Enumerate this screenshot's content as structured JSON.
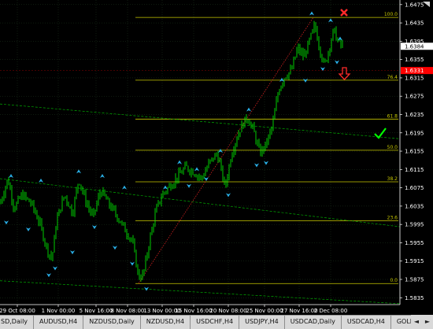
{
  "chart_data": {
    "type": "candlestick",
    "y_ticks": [
      "1.6475",
      "1.6435",
      "1.6395",
      "1.6355",
      "1.6315",
      "1.6275",
      "1.6235",
      "1.6195",
      "1.6155",
      "1.6115",
      "1.6075",
      "1.6035",
      "1.5995",
      "1.5955",
      "1.5915",
      "1.5875",
      "1.5835"
    ],
    "price_current": "1.6384",
    "price_marker": "1.6331",
    "x_ticks": [
      "29 Oct 08:00",
      "1 Nov 00:00",
      "5 Nov 16:00",
      "8 Nov 08:00",
      "13 Nov 00:00",
      "15 Nov 16:00",
      "20 Nov 08:00",
      "25 Nov 00:00",
      "27 Nov 16:00",
      "2 Dec 08:00"
    ],
    "fib_levels": [
      {
        "label": "100.0",
        "value": 1.6447
      },
      {
        "label": "76.4",
        "value": 1.631
      },
      {
        "label": "61.8",
        "value": 1.6225
      },
      {
        "label": "50.0",
        "value": 1.6157
      },
      {
        "label": "38.2",
        "value": 1.6088
      },
      {
        "label": "23.6",
        "value": 1.6003
      },
      {
        "label": "0.0",
        "value": 1.5866
      }
    ],
    "ylim": [
      1.582,
      1.6485
    ],
    "grid": true,
    "colors": {
      "background": "#000000",
      "candle": "#00ff00",
      "fib": "#c8c800",
      "trend": "#00aa00",
      "arrows": "#2ab0e8",
      "price_marker_bg": "#ff0000",
      "axis": "#ffffff"
    },
    "annotations": [
      "check-mark-icon",
      "x-mark-icon",
      "down-arrow-icon"
    ]
  },
  "tabs": [
    "SD,Daily",
    "AUDUSD,H4",
    "NZDUSD,Daily",
    "NZDUSD,H4",
    "USDCHF,H4",
    "USDJPY,H4",
    "USDCAD,Daily",
    "USDCAD,H4",
    "GOLD,Daily",
    "GOLD,H4"
  ],
  "tabnav": {
    "prev": "◄",
    "next": "►"
  }
}
